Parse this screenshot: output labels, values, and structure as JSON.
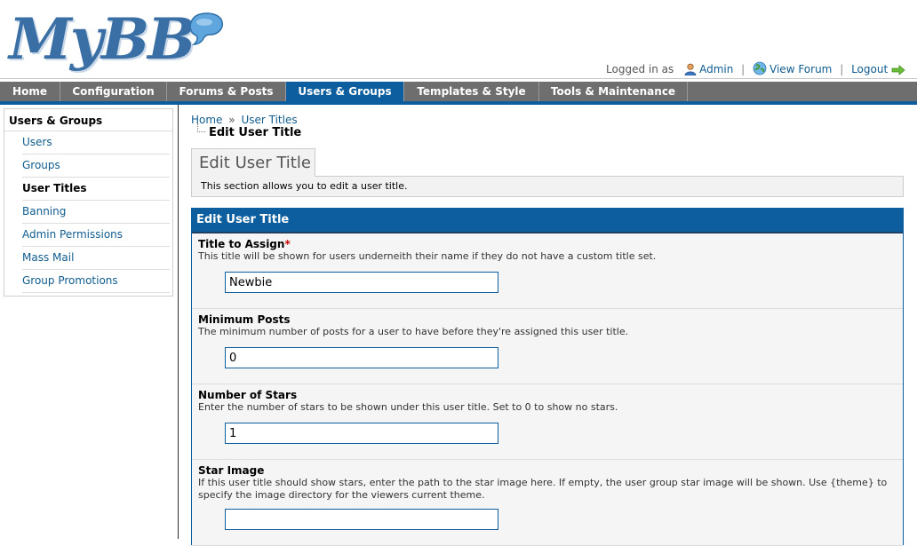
{
  "brand": {
    "logo_text": "MyBB"
  },
  "userbar": {
    "logged_in_as": "Logged in as",
    "admin": "Admin",
    "view_forum": "View Forum",
    "logout": "Logout"
  },
  "nav": {
    "tabs": [
      {
        "label": "Home"
      },
      {
        "label": "Configuration"
      },
      {
        "label": "Forums & Posts"
      },
      {
        "label": "Users & Groups"
      },
      {
        "label": "Templates & Style"
      },
      {
        "label": "Tools & Maintenance"
      }
    ],
    "active_index": 3
  },
  "sidebar": {
    "title": "Users & Groups",
    "items": [
      {
        "label": "Users"
      },
      {
        "label": "Groups"
      },
      {
        "label": "User Titles"
      },
      {
        "label": "Banning"
      },
      {
        "label": "Admin Permissions"
      },
      {
        "label": "Mass Mail"
      },
      {
        "label": "Group Promotions"
      }
    ],
    "active_index": 2
  },
  "breadcrumb": {
    "home": "Home",
    "separator": "»",
    "user_titles": "User Titles",
    "current": "Edit User Title"
  },
  "page": {
    "tab_title": "Edit User Title",
    "description": "This section allows you to edit a user title."
  },
  "form": {
    "heading": "Edit User Title",
    "required_mark": "*",
    "fields": [
      {
        "title": "Title to Assign",
        "description": "This title will be shown for users underneith their name if they do not have a custom title set.",
        "value": "Newbie"
      },
      {
        "title": "Minimum Posts",
        "description": "The minimum number of posts for a user to have before they're assigned this user title.",
        "value": "0"
      },
      {
        "title": "Number of Stars",
        "description": "Enter the number of stars to be shown under this user title. Set to 0 to show no stars.",
        "value": "1"
      },
      {
        "title": "Star Image",
        "description": "If this user title should show stars, enter the path to the star image here. If empty, the user group star image will be shown. Use {theme} to specify the image directory for the viewers current theme.",
        "value": ""
      }
    ]
  },
  "colors": {
    "accent": "#0c5e9e",
    "nav_bg": "#6e6e6e",
    "link": "#0f5c8e",
    "required": "#cc0000"
  }
}
